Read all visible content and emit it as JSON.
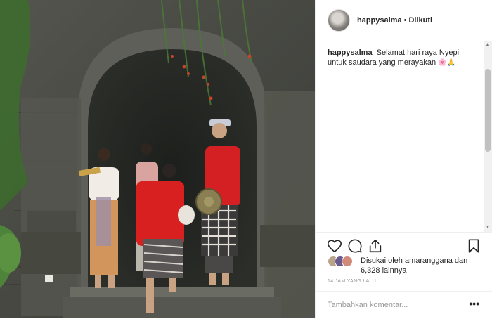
{
  "post": {
    "image_alt": "",
    "header": {
      "username": "happysalma",
      "separator": "•",
      "follow_status": "Diikuti"
    },
    "caption": {
      "username": "happysalma",
      "text": "Selamat hari raya Nyepi untuk saudara yang merayakan",
      "emojis": "🌸🙏"
    },
    "actions": {
      "like_icon": "heart-icon",
      "comment_icon": "comment-icon",
      "share_icon": "share-icon",
      "save_icon": "bookmark-icon"
    },
    "likes": {
      "text": "Disukai oleh amaranggana dan 6,328 lainnya"
    },
    "timestamp": "14 JAM YANG LALU",
    "comment_box": {
      "placeholder": "Tambahkan komentar...",
      "more_label": "•••"
    },
    "colors": {
      "text": "#262626",
      "muted": "#999999",
      "border": "#efefef"
    }
  }
}
